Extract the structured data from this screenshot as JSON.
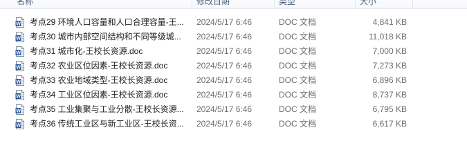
{
  "columns": {
    "name": "名称",
    "date": "修改日期",
    "type": "类型",
    "size": "大小"
  },
  "icons": {
    "file": "word-doc-icon",
    "accent": "#2b5797"
  },
  "files": [
    {
      "name": "考点29 环境人口容量和人口合理容量-王...",
      "date": "2024/5/17 6:46",
      "type": "DOC 文档",
      "size": "4,841 KB"
    },
    {
      "name": "考点30 城市内部空间结构和不同等级城...",
      "date": "2024/5/17 6:46",
      "type": "DOC 文档",
      "size": "11,018 KB"
    },
    {
      "name": "考点31 城市化-王校长资源.doc",
      "date": "2024/5/17 6:46",
      "type": "DOC 文档",
      "size": "7,000 KB"
    },
    {
      "name": "考点32 农业区位因素-王校长资源.doc",
      "date": "2024/5/17 6:46",
      "type": "DOC 文档",
      "size": "7,273 KB"
    },
    {
      "name": "考点33 农业地域类型-王校长资源.doc",
      "date": "2024/5/17 6:46",
      "type": "DOC 文档",
      "size": "6,896 KB"
    },
    {
      "name": "考点34 工业区位因素-王校长资源.doc",
      "date": "2024/5/17 6:46",
      "type": "DOC 文档",
      "size": "8,737 KB"
    },
    {
      "name": "考点35 工业集聚与工业分散-王校长资源...",
      "date": "2024/5/17 6:46",
      "type": "DOC 文档",
      "size": "6,795 KB"
    },
    {
      "name": "考点36 传统工业区与新工业区-王校长资...",
      "date": "2024/5/17 6:46",
      "type": "DOC 文档",
      "size": "6,617 KB"
    }
  ]
}
